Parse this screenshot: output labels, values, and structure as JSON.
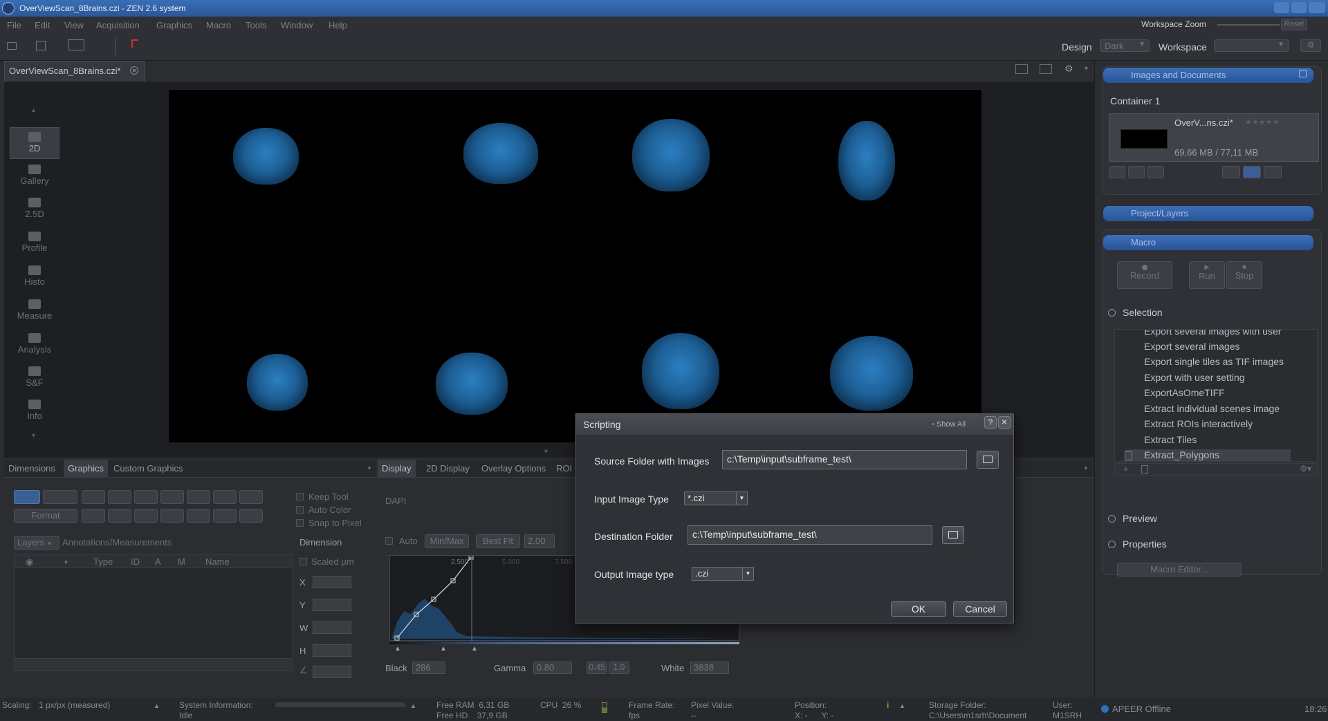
{
  "window": {
    "title": "OverViewScan_8Brains.czi - ZEN 2.6 system",
    "workspace_zoom_label": "Workspace Zoom",
    "reset_label": "Reset"
  },
  "menu": [
    "File",
    "Edit",
    "View",
    "Acquisition",
    "Graphics",
    "Macro",
    "Tools",
    "Window",
    "Help"
  ],
  "toolbar": {
    "design_label": "Design",
    "design_value": "Dark",
    "workspace_label": "Workspace",
    "workspace_value": ""
  },
  "document_tab": {
    "label": "OverViewScan_8Brains.czi*"
  },
  "view_modes": [
    "2D",
    "Gallery",
    "2.5D",
    "Profile",
    "Histo",
    "Measure",
    "Analysis",
    "S&F",
    "Info"
  ],
  "left_tabs": {
    "dimensions": "Dimensions",
    "graphics": "Graphics",
    "custom_graphics": "Custom Graphics"
  },
  "graphics_panel": {
    "format_label": "Format",
    "keep_tool": "Keep Tool",
    "auto_color": "Auto Color",
    "snap_to_pixel": "Snap to Pixel",
    "layers_label": "Layers",
    "annotations_label": "Annotations/Measurements",
    "dimension_label": "Dimension",
    "scaled_label": "Scaled µm",
    "table_headers": [
      "Type",
      "ID",
      "A",
      "M",
      "Name"
    ],
    "coords": [
      "X",
      "Y",
      "W",
      "H"
    ]
  },
  "display_tabs": {
    "display": "Display",
    "display_2d": "2D Display",
    "overlay": "Overlay Options",
    "roi": "ROI"
  },
  "display_panel": {
    "channel": "DAPI",
    "auto_label": "Auto",
    "minmax_label": "Min/Max",
    "bestfit_label": "Best Fit",
    "gamma_field": "2.00",
    "black_label": "Black",
    "black_value": "286",
    "gamma_label": "Gamma",
    "gamma_value": "0.80",
    "preset_045": "0.45",
    "preset_10": "1.0",
    "white_label": "White",
    "white_value": "3838",
    "tick_2500": "2.500",
    "tick_5000": "5.000",
    "tick_7500": "7.500"
  },
  "right_panel": {
    "images_docs_title": "Images and Documents",
    "container": "Container 1",
    "doc_name": "OverV...ns.czi*",
    "doc_size": "69,66 MB / 77,11 MB",
    "project_layers": "Project/Layers",
    "macro_title": "Macro",
    "record": "Record",
    "run": "Run",
    "stop": "Stop",
    "selection": "Selection",
    "macros": [
      "Export several images with user",
      "Export several images",
      "Export single tiles as TIF images",
      "Export with user setting",
      "ExportAsOmeTIFF",
      "Extract individual scenes image",
      "Extract ROIs interactively",
      "Extract Tiles",
      "Extract_Polygons"
    ],
    "preview": "Preview",
    "properties": "Properties",
    "macro_editor": "Macro Editor..."
  },
  "dialog": {
    "title": "Scripting",
    "show_all": "Show All",
    "help": "?",
    "close": "×",
    "source_label": "Source Folder with Images",
    "source_value": "c:\\Temp\\input\\subframe_test\\",
    "input_type_label": "Input Image Type",
    "input_type_value": "*.czi",
    "dest_label": "Destination Folder",
    "dest_value": "c:\\Temp\\input\\subframe_test\\",
    "output_type_label": "Output Image type",
    "output_type_value": ".czi",
    "ok": "OK",
    "cancel": "Cancel"
  },
  "status": {
    "scaling_label": "Scaling:",
    "scaling_value": "1 px/px (measured)",
    "sysinfo_label": "System Information:",
    "sysinfo_value": "Idle",
    "free_ram": "Free RAM  6,31 GB",
    "free_hd": "Free HD    37,9 GB",
    "cpu": "CPU  26 %",
    "frame_rate_label": "Frame Rate:",
    "frame_rate_value": "fps",
    "pixel_value_label": "Pixel Value:",
    "pixel_value_value": "--",
    "position_label": "Position:",
    "position_value": "X: -      Y: -",
    "storage_label": "Storage Folder:",
    "storage_value": "C:\\Users\\m1srh\\Document",
    "user_label": "User:",
    "user_value": "M1SRH",
    "apeer": "APEER Offline",
    "time": "18:26"
  },
  "colors": {
    "accent": "#3a6fb5",
    "brain": "#2c7fc0",
    "background": "#2b2d31"
  }
}
